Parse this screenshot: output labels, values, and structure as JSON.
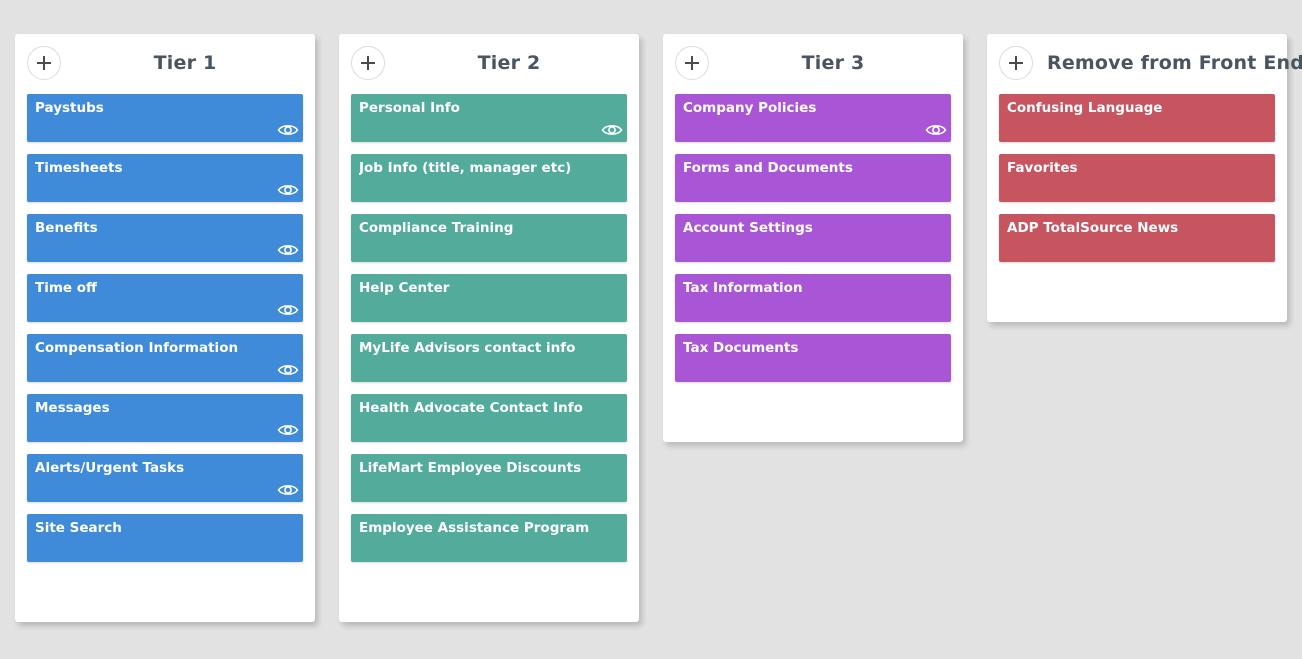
{
  "colors": {
    "background": "#e2e2e2",
    "tier1": "#3f8bd9",
    "tier2": "#53ab9c",
    "tier3": "#a856d6",
    "remove": "#c65560"
  },
  "columns": [
    {
      "title": "Tier 1",
      "color": "#3f8bd9",
      "cards": [
        {
          "label": "Paystubs",
          "visible_icon": "eye-icon"
        },
        {
          "label": "Timesheets",
          "visible_icon": "eye-icon"
        },
        {
          "label": "Benefits",
          "visible_icon": "eye-icon"
        },
        {
          "label": "Time off",
          "visible_icon": "eye-icon"
        },
        {
          "label": "Compensation Information",
          "visible_icon": "eye-icon"
        },
        {
          "label": "Messages",
          "visible_icon": "eye-icon"
        },
        {
          "label": "Alerts/Urgent Tasks",
          "visible_icon": "eye-icon"
        },
        {
          "label": "Site Search"
        }
      ]
    },
    {
      "title": "Tier 2",
      "color": "#53ab9c",
      "cards": [
        {
          "label": "Personal Info",
          "visible_icon": "eye-icon"
        },
        {
          "label": "Job Info (title, manager etc)"
        },
        {
          "label": "Compliance Training"
        },
        {
          "label": "Help Center"
        },
        {
          "label": "MyLife Advisors contact info"
        },
        {
          "label": "Health Advocate Contact Info"
        },
        {
          "label": "LifeMart Employee Discounts"
        },
        {
          "label": "Employee Assistance Program"
        }
      ]
    },
    {
      "title": "Tier 3",
      "color": "#a856d6",
      "cards": [
        {
          "label": "Company Policies",
          "visible_icon": "eye-icon"
        },
        {
          "label": "Forms and Documents"
        },
        {
          "label": "Account Settings"
        },
        {
          "label": "Tax Information"
        },
        {
          "label": "Tax Documents"
        }
      ]
    },
    {
      "title": "Remove from Front End",
      "color": "#c65560",
      "cards": [
        {
          "label": "Confusing Language"
        },
        {
          "label": "Favorites"
        },
        {
          "label": "ADP TotalSource News"
        }
      ]
    }
  ]
}
